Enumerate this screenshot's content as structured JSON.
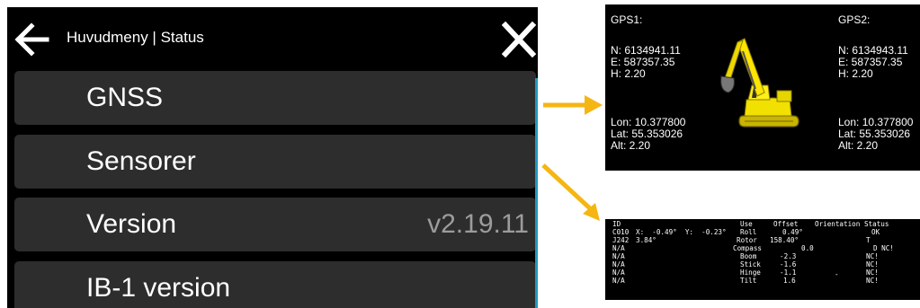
{
  "app": {
    "header_title": "Huvudmeny | Status",
    "back_icon": "arrow-left-icon",
    "close_icon": "close-icon",
    "accent_color": "#1e9ac2",
    "menu": [
      {
        "label": "GNSS",
        "value": ""
      },
      {
        "label": "Sensorer",
        "value": ""
      },
      {
        "label": "Version",
        "value": "v2.19.11"
      },
      {
        "label": "IB-1 version",
        "value": ""
      }
    ]
  },
  "arrow_color": "#f5b614",
  "gps_panel": {
    "gps1": {
      "heading": "GPS1:",
      "n": "N: 6134941.11",
      "e": "E: 587357.35",
      "h": "H: 2.20",
      "lon": "Lon: 10.377800",
      "lat": "Lat: 55.353026",
      "alt": "Alt: 2.20"
    },
    "gps2": {
      "heading": "GPS2:",
      "n": "N: 6134943.11",
      "e": "E: 587357.35",
      "h": "H: 2.20",
      "lon": "Lon: 10.377800",
      "lat": "Lat: 55.353026",
      "alt": "Alt: 2.20"
    },
    "machine_icon": "excavator-icon"
  },
  "sensor_panel": {
    "headers": {
      "id": "ID",
      "use": "Use",
      "offset": "Offset",
      "orientation": "Orientation",
      "status": "Status"
    },
    "left_rows": [
      {
        "id": "C010",
        "detail": "X:  -0.49°  Y:  -0.23°"
      },
      {
        "id": "J242",
        "detail": "3.84°"
      },
      {
        "id": "N/A",
        "detail": ""
      },
      {
        "id": "N/A",
        "detail": ""
      },
      {
        "id": "N/A",
        "detail": ""
      },
      {
        "id": "N/A",
        "detail": ""
      },
      {
        "id": "N/A",
        "detail": ""
      }
    ],
    "right_rows": [
      {
        "use": "Roll",
        "offset": "0.49°",
        "orientation": "",
        "status": "OK"
      },
      {
        "use": "Rotor",
        "offset": "158.40°",
        "orientation": "",
        "status": "T"
      },
      {
        "use": "Compass",
        "offset": "0.0",
        "orientation": "",
        "status": "D NC!"
      },
      {
        "use": "Boom",
        "offset": "-2.3",
        "orientation": "",
        "status": "NC!"
      },
      {
        "use": "Stick",
        "offset": "-1.6",
        "orientation": "",
        "status": "NC!"
      },
      {
        "use": "Hinge",
        "offset": "-1.1",
        "orientation": "-",
        "status": "NC!"
      },
      {
        "use": "Tilt",
        "offset": "1.6",
        "orientation": "",
        "status": "NC!"
      }
    ]
  }
}
